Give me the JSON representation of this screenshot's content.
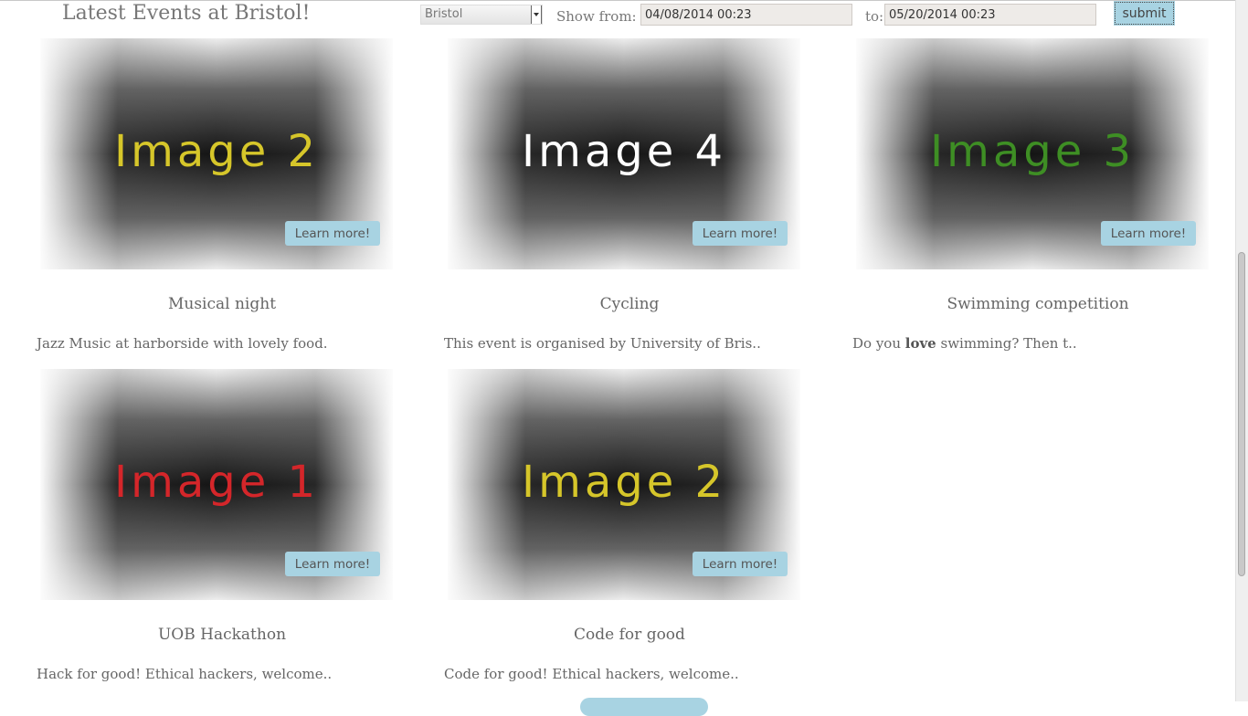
{
  "header": {
    "title": "Latest Events at Bristol!",
    "location_select": {
      "value": "Bristol"
    },
    "from_label": "Show from:",
    "from_value": "04/08/2014 00:23",
    "to_label": "to:",
    "to_value": "05/20/2014 00:23",
    "submit_label": "submit"
  },
  "events": [
    {
      "image_text": "Image 2",
      "image_color": "#d6c62a",
      "button": "Learn more!",
      "title": "Musical night",
      "desc": "Jazz Music at harborside with lovely food."
    },
    {
      "image_text": "Image 4",
      "image_color": "#ffffff",
      "button": "Learn more!",
      "title": "Cycling",
      "desc": "This event is organised by University of Bris.."
    },
    {
      "image_text": "Image 3",
      "image_color": "#3e8e24",
      "button": "Learn more!",
      "title": "Swimming competition",
      "desc_before": "Do you ",
      "desc_bold": "love",
      "desc_after": " swimming? Then t.."
    },
    {
      "image_text": "Image 1",
      "image_color": "#d4262a",
      "button": "Learn more!",
      "title": "UOB Hackathon",
      "desc": "Hack for good! Ethical hackers, welcome.."
    },
    {
      "image_text": "Image 2",
      "image_color": "#d6c62a",
      "button": "Learn more!",
      "title": "Code for good",
      "desc": "Code for good! Ethical hackers, welcome.."
    }
  ],
  "colors": {
    "accent": "#a8d3e2",
    "text": "#666666"
  }
}
